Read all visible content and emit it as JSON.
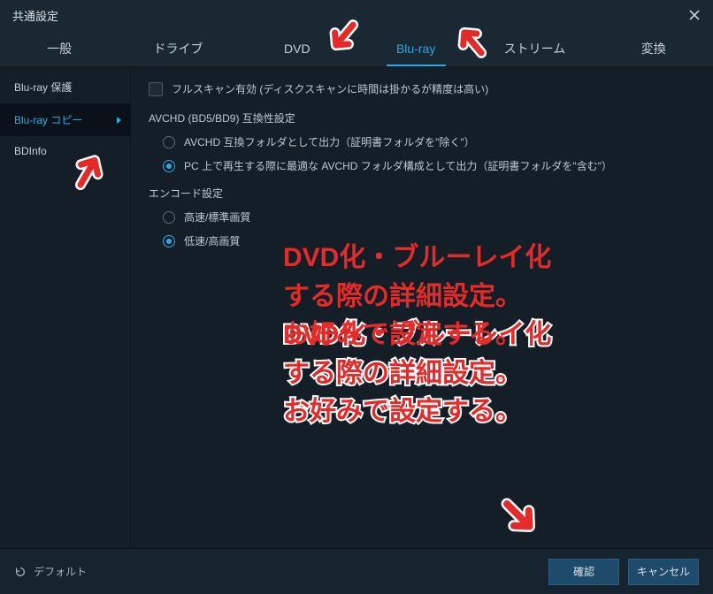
{
  "window": {
    "title": "共通設定"
  },
  "tabs": [
    {
      "label": "一般"
    },
    {
      "label": "ドライブ"
    },
    {
      "label": "DVD"
    },
    {
      "label": "Blu-ray"
    },
    {
      "label": "ストリーム"
    },
    {
      "label": "変換"
    }
  ],
  "sidebar": {
    "items": [
      {
        "label": "Blu-ray 保護"
      },
      {
        "label": "Blu-ray コピー"
      },
      {
        "label": "BDInfo"
      }
    ]
  },
  "content": {
    "fullscan_label": "フルスキャン有効 (ディスクスキャンに時間は掛かるが精度は高い)",
    "avchd_section": "AVCHD (BD5/BD9) 互換性設定",
    "avchd_opt1": "AVCHD 互換フォルダとして出力（証明書フォルダを\"除く\"）",
    "avchd_opt2": "PC 上で再生する際に最適な AVCHD フォルダ構成として出力（証明書フォルダを\"含む\"）",
    "encode_section": "エンコード設定",
    "encode_opt1": "高速/標準画質",
    "encode_opt2": "低速/高画質"
  },
  "footer": {
    "default_label": "デフォルト",
    "ok_label": "確認",
    "cancel_label": "キャンセル"
  },
  "annotation": {
    "text": "DVD化・ブルーレイ化\nする際の詳細設定。\nお好みで設定する。"
  },
  "colors": {
    "accent": "#2aa8e0",
    "annotation_red": "#e52a2a"
  }
}
